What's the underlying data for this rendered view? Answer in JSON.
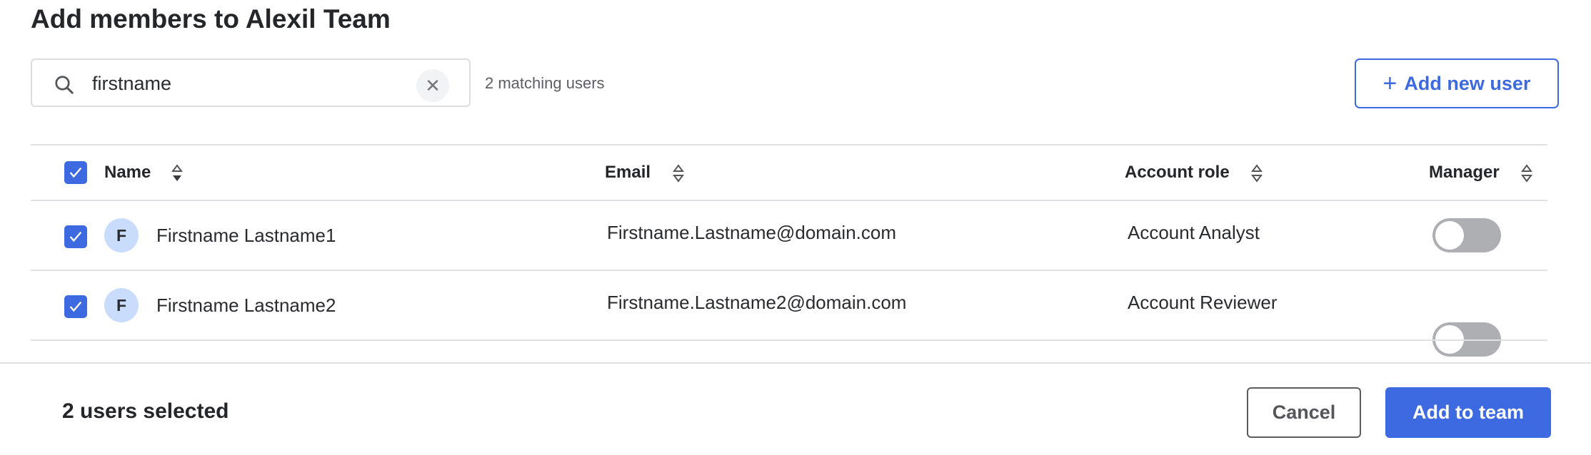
{
  "title": "Add members to Alexil Team",
  "search": {
    "value": "firstname",
    "icon": "search-icon",
    "clear_icon": "close-icon"
  },
  "matching_text": "2 matching users",
  "add_new_user_label": "Add new user",
  "table": {
    "columns": [
      "Name",
      "Email",
      "Account role",
      "Manager"
    ],
    "select_all_checked": true,
    "rows": [
      {
        "checked": true,
        "initial": "F",
        "name": "Firstname Lastname1",
        "email": "Firstname.Lastname@domain.com",
        "role": "Account Analyst",
        "manager": false
      },
      {
        "checked": true,
        "initial": "F",
        "name": "Firstname Lastname2",
        "email": "Firstname.Lastname2@domain.com",
        "role": "Account Reviewer",
        "manager": false
      }
    ]
  },
  "footer": {
    "selected_text": "2 users selected",
    "cancel_label": "Cancel",
    "add_label": "Add to team"
  },
  "colors": {
    "accent": "#3e6ae1",
    "avatar_bg": "#c9dcfb",
    "toggle_off": "#aeafb3"
  }
}
